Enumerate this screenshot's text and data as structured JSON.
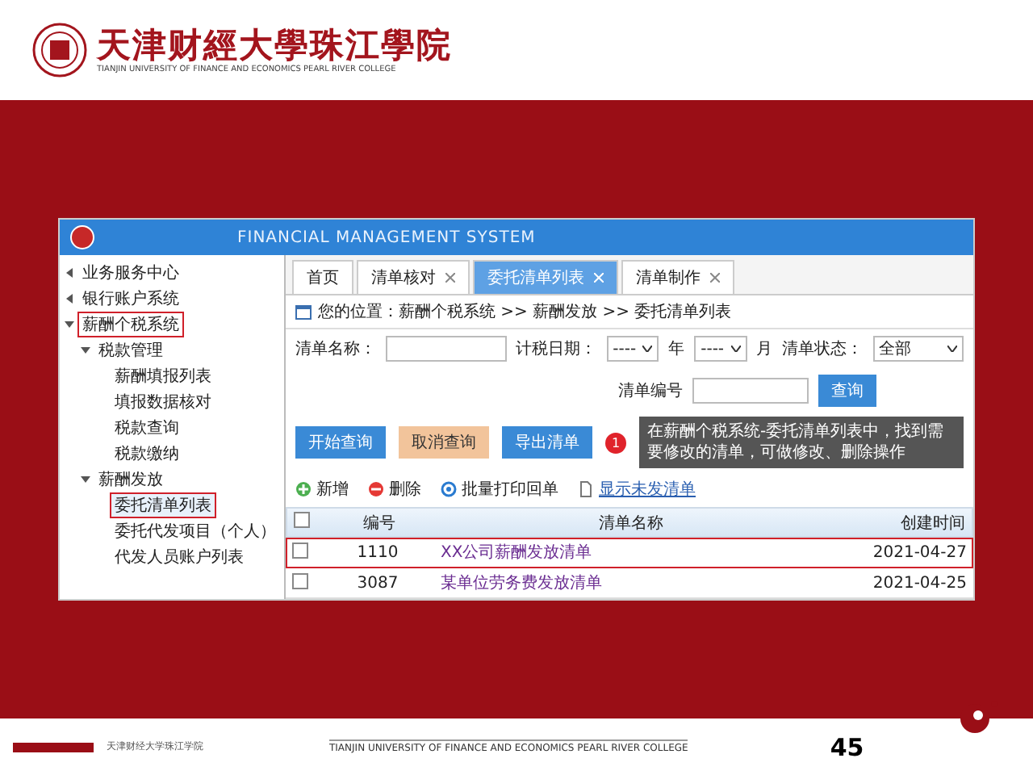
{
  "header": {
    "logo_text": "天津财經大學珠江學院",
    "logo_subtitle": "TIANJIN UNIVERSITY OF FINANCE AND ECONOMICS PEARL RIVER COLLEGE"
  },
  "screenshot": {
    "system_title": "FINANCIAL MANAGEMENT SYSTEM",
    "sidebar": [
      {
        "label": "业务服务中心",
        "expanded": false,
        "highlighted": false,
        "selected": false
      },
      {
        "label": "银行账户系统",
        "expanded": false,
        "highlighted": false,
        "selected": false
      },
      {
        "label": "薪酬个税系统",
        "expanded": true,
        "highlighted": true,
        "selected": false,
        "children": [
          {
            "label": "税款管理",
            "expanded": true,
            "highlighted": false,
            "selected": false,
            "children": [
              {
                "label": "薪酬填报列表",
                "highlighted": false,
                "selected": false
              },
              {
                "label": "填报数据核对",
                "highlighted": false,
                "selected": false
              },
              {
                "label": "税款查询",
                "highlighted": false,
                "selected": false
              },
              {
                "label": "税款缴纳",
                "highlighted": false,
                "selected": false
              }
            ]
          },
          {
            "label": "薪酬发放",
            "expanded": true,
            "highlighted": false,
            "selected": false,
            "children": [
              {
                "label": "委托清单列表",
                "highlighted": true,
                "selected": true
              },
              {
                "label": "委托代发项目（个人）",
                "highlighted": false,
                "selected": false
              },
              {
                "label": "代发人员账户列表",
                "highlighted": false,
                "selected": false
              }
            ]
          }
        ]
      }
    ],
    "tabs": [
      {
        "label": "首页",
        "selected": false,
        "closable": false
      },
      {
        "label": "清单核对",
        "selected": false,
        "closable": true
      },
      {
        "label": "委托清单列表",
        "selected": true,
        "closable": true
      },
      {
        "label": "清单制作",
        "selected": false,
        "closable": true
      }
    ],
    "breadcrumb": "您的位置：薪酬个税系统 >> 薪酬发放 >> 委托清单列表",
    "filters": [
      {
        "kind": "input",
        "label": "清单名称："
      },
      {
        "kind": "date",
        "label": "计税日期：",
        "year": "----",
        "year_unit": "年",
        "month": "----",
        "month_unit": "月"
      },
      {
        "kind": "select",
        "label": "清单状态：",
        "value": "全部"
      }
    ],
    "search_row": {
      "label": "清单编号",
      "button": "查询"
    },
    "buttons": [
      {
        "label": "开始查询",
        "kind": "primary"
      },
      {
        "label": "取消查询",
        "kind": "warning"
      },
      {
        "label": "导出清单",
        "kind": "primary"
      }
    ],
    "tooltip": {
      "badge": "1",
      "text": "在薪酬个税系统-委托清单列表中，找到需要修改的清单，可做修改、删除操作"
    },
    "toolbar": [
      {
        "label": "新增",
        "kind": "add"
      },
      {
        "label": "删除",
        "kind": "delete"
      },
      {
        "label": "批量打印回单",
        "kind": "print"
      },
      {
        "label": "显示未发清单",
        "kind": "doc"
      }
    ],
    "table": {
      "columns": [
        "编号",
        "清单名称",
        "创建时间"
      ],
      "header_checked": false,
      "rows": [
        {
          "checked": false,
          "highlighted": true,
          "cells": [
            "1110",
            "XX公司薪酬发放清单",
            "2021-04-27"
          ]
        },
        {
          "checked": false,
          "highlighted": false,
          "cells": [
            "3087",
            "某单位劳务费发放清单",
            "2021-04-25"
          ]
        }
      ]
    }
  },
  "footer": {
    "school": "天津财经大学珠江学院",
    "english": "TIANJIN UNIVERSITY OF FINANCE AND ECONOMICS PEARL RIVER COLLEGE",
    "page": "45"
  }
}
